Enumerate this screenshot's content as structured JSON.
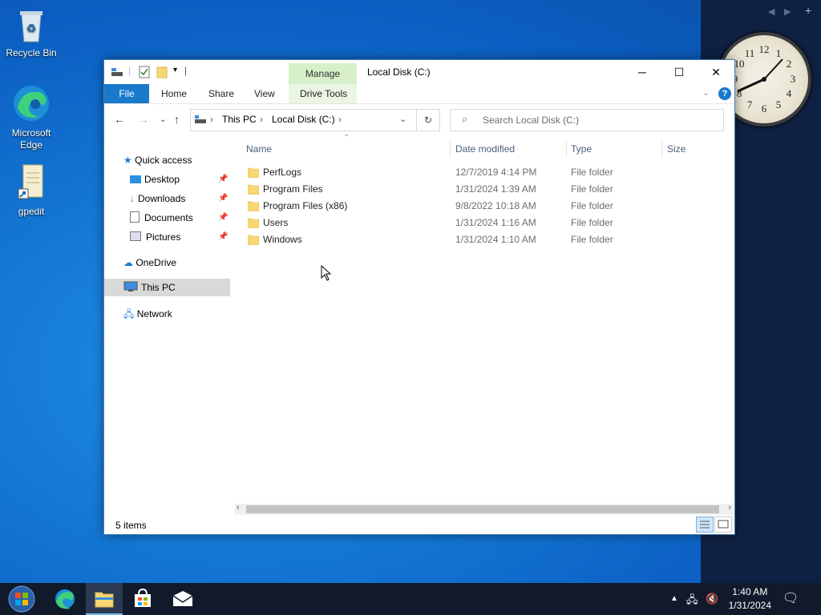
{
  "desktop": {
    "icons": [
      {
        "label": "Recycle Bin"
      },
      {
        "label": "Microsoft Edge"
      },
      {
        "label": "gpedit"
      }
    ]
  },
  "clock": {
    "numerals": [
      "12",
      "1",
      "2",
      "3",
      "4",
      "5",
      "6",
      "7",
      "8",
      "9",
      "10",
      "11"
    ]
  },
  "window": {
    "title": "Local Disk (C:)",
    "contextual_tab": "Manage",
    "ribbon_tabs": [
      "File",
      "Home",
      "Share",
      "View",
      "Drive Tools"
    ],
    "address": [
      "This PC",
      "Local Disk (C:)"
    ],
    "search_placeholder": "Search Local Disk (C:)",
    "nav_pane": {
      "quick_access": "Quick access",
      "pinned": [
        "Desktop",
        "Downloads",
        "Documents",
        "Pictures"
      ],
      "onedrive": "OneDrive",
      "this_pc": "This PC",
      "network": "Network"
    },
    "columns": [
      "Name",
      "Date modified",
      "Type",
      "Size"
    ],
    "rows": [
      {
        "name": "PerfLogs",
        "date": "12/7/2019 4:14 PM",
        "type": "File folder"
      },
      {
        "name": "Program Files",
        "date": "1/31/2024 1:39 AM",
        "type": "File folder"
      },
      {
        "name": "Program Files (x86)",
        "date": "9/8/2022 10:18 AM",
        "type": "File folder"
      },
      {
        "name": "Users",
        "date": "1/31/2024 1:16 AM",
        "type": "File folder"
      },
      {
        "name": "Windows",
        "date": "1/31/2024 1:10 AM",
        "type": "File folder"
      }
    ],
    "status": "5 items"
  },
  "taskbar": {
    "time": "1:40 AM",
    "date": "1/31/2024"
  },
  "colors": {
    "accent": "#1979ca",
    "manage_tab": "#d7f0c9",
    "selection": "#d9d9d9",
    "folder": "#f8d775"
  }
}
